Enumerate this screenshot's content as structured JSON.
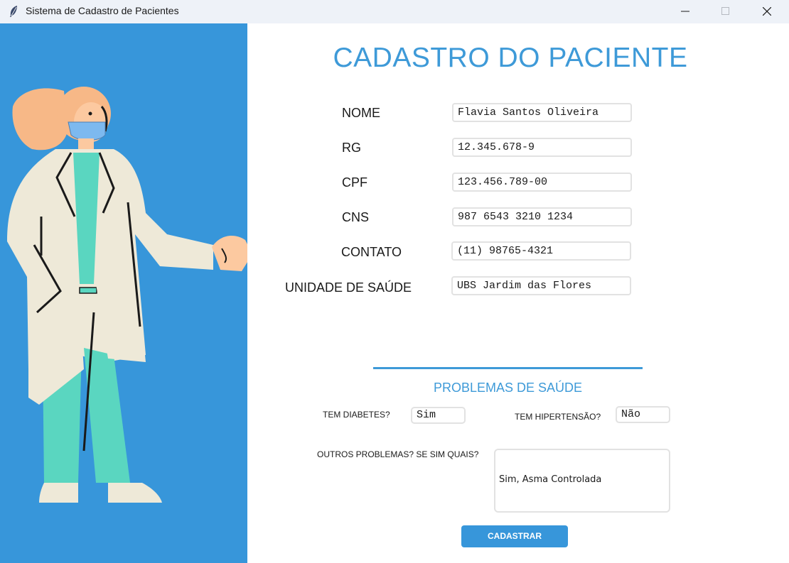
{
  "window": {
    "title": "Sistema de Cadastro de Pacientes",
    "app_icon": "feather-icon",
    "controls": [
      "minimize-icon",
      "maximize-icon",
      "close-icon"
    ]
  },
  "colors": {
    "accent": "#3e9ad8",
    "side_panel": "#3796da",
    "button": "#3796da"
  },
  "illustration": "doctor-illustration",
  "form": {
    "title": "CADASTRO DO PACIENTE",
    "fields": [
      {
        "label": "NOME",
        "value": "Flavia Santos Oliveira"
      },
      {
        "label": "RG",
        "value": "12.345.678-9"
      },
      {
        "label": "CPF",
        "value": "123.456.789-00"
      },
      {
        "label": "CNS",
        "value": "987 6543 3210 1234"
      },
      {
        "label": "CONTATO",
        "value": "(11) 98765-4321"
      },
      {
        "label": "UNIDADE DE SAÚDE",
        "value": "UBS Jardim das Flores"
      }
    ]
  },
  "health": {
    "title": "PROBLEMAS DE SAÚDE",
    "diabetes_label": "TEM DIABETES?",
    "diabetes_value": "Sim",
    "hypertension_label": "TEM HIPERTENSÃO?",
    "hypertension_value": "Não",
    "others_label": "OUTROS PROBLEMAS? SE SIM QUAIS?",
    "others_value": "Sim, Asma Controlada"
  },
  "submit_label": "CADASTRAR"
}
